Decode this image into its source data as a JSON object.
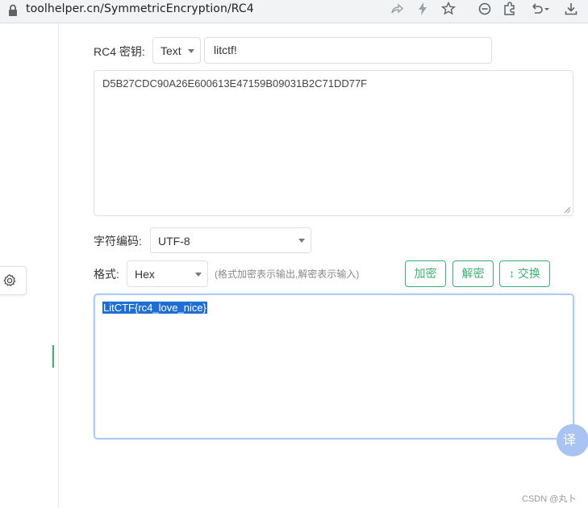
{
  "browser": {
    "url": "toolhelper.cn/SymmetricEncryption/RC4"
  },
  "form": {
    "key_label": "RC4 密钥:",
    "key_type": "Text",
    "key_value": "litctf!",
    "input_text": "D5B27CDC90A26E600613E47159B09031B2C71DD77F",
    "encoding_label": "字符编码:",
    "encoding_value": "UTF-8",
    "format_label": "格式:",
    "format_value": "Hex",
    "format_hint": "(格式加密表示输出,解密表示输入)",
    "encrypt_label": "加密",
    "decrypt_label": "解密",
    "swap_label": "↕ 交换",
    "output_text": "LitCTF{rc4_love_nice}"
  },
  "overlay": {
    "translate_label": "译",
    "watermark": "CSDN @丸卜"
  },
  "colors": {
    "accent": "#3bb273",
    "selection": "#1f6ed4",
    "focus_border": "#aecbf5"
  }
}
